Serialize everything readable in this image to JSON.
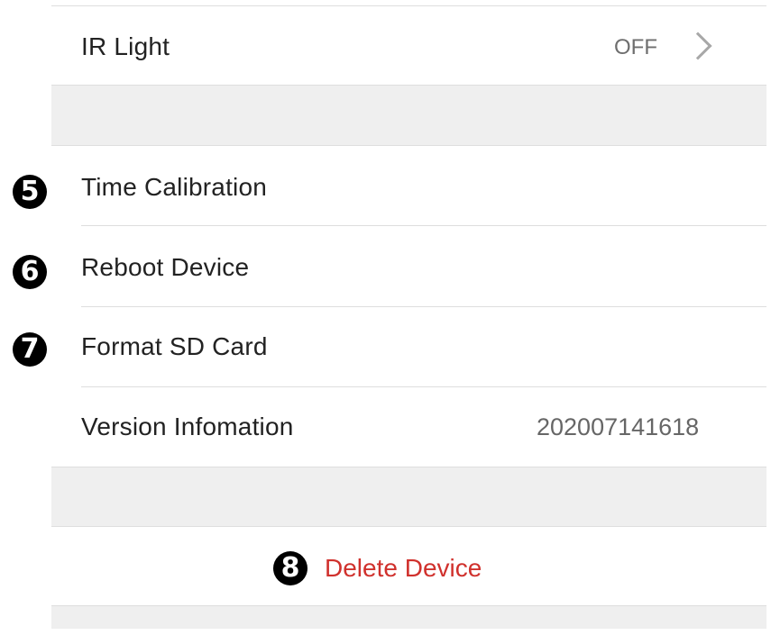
{
  "settings": {
    "ir_light": {
      "label": "IR Light",
      "value": "OFF"
    },
    "time_calibration": {
      "label": "Time Calibration",
      "step": "5"
    },
    "reboot_device": {
      "label": "Reboot Device",
      "step": "6"
    },
    "format_sd_card": {
      "label": "Format SD Card",
      "step": "7"
    },
    "version": {
      "label": "Version Infomation",
      "value": "202007141618"
    }
  },
  "delete": {
    "label": "Delete Device",
    "step": "8"
  },
  "colors": {
    "delete_text": "#d0312d",
    "section_gap": "#efefef",
    "divider": "#dedede",
    "badge": "#000000"
  },
  "icons": {
    "chevron": "chevron-right-icon",
    "step_badge": "numbered-circle-icon"
  }
}
